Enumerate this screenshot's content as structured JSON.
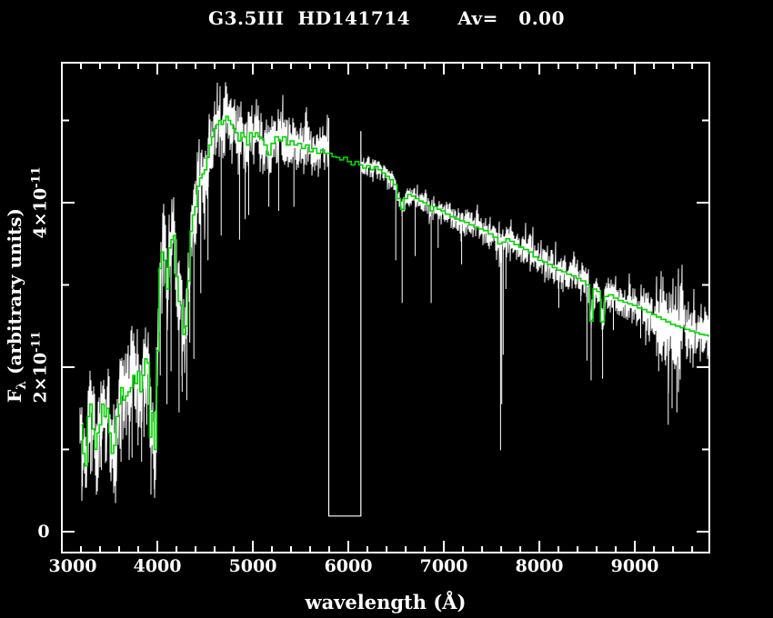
{
  "title": {
    "text": "G3.5III  HD141714       Av=   0.00"
  },
  "chart_data": {
    "type": "line",
    "title": "G3.5III  HD141714       Av=   0.00",
    "star": {
      "spectral_type": "G3.5III",
      "identifier": "HD141714",
      "av_label": "Av=",
      "av_value": "0.00"
    },
    "xlabel": "wavelength (Å)",
    "ylabel": "F_λ (arbitrary units)",
    "ylabel_parts": {
      "main": "F",
      "sub": "λ",
      "rest": " (arbitrary units)"
    },
    "flux_values_unit": "×10⁻¹¹ (arbitrary units)",
    "xlim": [
      3000,
      9780
    ],
    "ylim": [
      -0.25,
      5.7
    ],
    "grid": false,
    "legend": "none",
    "x_major_ticks": [
      3000,
      4000,
      5000,
      6000,
      7000,
      8000,
      9000
    ],
    "x_tick_labels": [
      "3000",
      "4000",
      "5000",
      "6000",
      "7000",
      "8000",
      "9000"
    ],
    "x_minor_step": 200,
    "y_major_ticks": [
      0,
      2,
      4
    ],
    "y_minor_ticks": [
      1,
      3,
      5
    ],
    "y_tick_labels": [
      {
        "value": 0,
        "label": "0"
      },
      {
        "value": 2,
        "base": "2×10",
        "exp": "-11"
      },
      {
        "value": 4,
        "base": "4×10",
        "exp": "-11"
      }
    ],
    "gap_box": {
      "x1": 5795,
      "x2": 6131,
      "top_left_flux": 5.03,
      "top_right_flux": 4.87,
      "bottom_flux": 0.19
    },
    "series": [
      {
        "name": "observed-spectrum",
        "color": "#ffffff",
        "style": "noisy",
        "x_start": 3185,
        "x_end": 9780,
        "gap": [
          5796,
          6130
        ],
        "noise_envelope": [
          [
            3185,
            0.45
          ],
          [
            3300,
            0.5
          ],
          [
            3450,
            0.5
          ],
          [
            3600,
            0.5
          ],
          [
            3750,
            0.5
          ],
          [
            3900,
            0.55
          ],
          [
            4000,
            0.5
          ],
          [
            4150,
            0.45
          ],
          [
            4300,
            0.42
          ],
          [
            4450,
            0.38
          ],
          [
            4600,
            0.35
          ],
          [
            4750,
            0.33
          ],
          [
            4900,
            0.32
          ],
          [
            5050,
            0.3
          ],
          [
            5200,
            0.28
          ],
          [
            5350,
            0.27
          ],
          [
            5500,
            0.25
          ],
          [
            5650,
            0.23
          ],
          [
            5795,
            0.21
          ],
          [
            6131,
            0.09
          ],
          [
            6300,
            0.09
          ],
          [
            6500,
            0.1
          ],
          [
            6700,
            0.1
          ],
          [
            6900,
            0.11
          ],
          [
            7100,
            0.12
          ],
          [
            7300,
            0.13
          ],
          [
            7500,
            0.14
          ],
          [
            7700,
            0.15
          ],
          [
            7900,
            0.16
          ],
          [
            8100,
            0.16
          ],
          [
            8300,
            0.17
          ],
          [
            8500,
            0.17
          ],
          [
            8700,
            0.17
          ],
          [
            8900,
            0.18
          ],
          [
            9050,
            0.2
          ],
          [
            9200,
            0.28
          ],
          [
            9300,
            0.5
          ],
          [
            9400,
            0.52
          ],
          [
            9500,
            0.4
          ],
          [
            9600,
            0.3
          ],
          [
            9700,
            0.28
          ],
          [
            9780,
            0.28
          ]
        ],
        "absorption_lines": [
          [
            3216,
            0.55
          ],
          [
            3248,
            0.58
          ],
          [
            3302,
            0.7
          ],
          [
            3415,
            0.75
          ],
          [
            3505,
            0.72
          ],
          [
            3560,
            0.7
          ],
          [
            3620,
            0.85
          ],
          [
            3735,
            0.9
          ],
          [
            3798,
            1.05
          ],
          [
            3835,
            0.85
          ],
          [
            3860,
            1.15
          ],
          [
            3890,
            1.3
          ],
          [
            3933,
            0.45
          ],
          [
            3968,
            0.52
          ],
          [
            4030,
            1.9
          ],
          [
            4101,
            1.55
          ],
          [
            4144,
            1.95
          ],
          [
            4227,
            1.45
          ],
          [
            4260,
            1.7
          ],
          [
            4308,
            1.6
          ],
          [
            4340,
            2.3
          ],
          [
            4383,
            2.1
          ],
          [
            4455,
            2.9
          ],
          [
            4530,
            3.3
          ],
          [
            4668,
            3.6
          ],
          [
            4861,
            3.55
          ],
          [
            4920,
            3.8
          ],
          [
            4957,
            3.85
          ],
          [
            5167,
            3.95
          ],
          [
            5270,
            3.9
          ],
          [
            5430,
            3.95
          ],
          [
            6497,
            3.3
          ],
          [
            6563,
            2.78
          ],
          [
            6700,
            3.35
          ],
          [
            6867,
            2.78
          ],
          [
            6940,
            3.45
          ],
          [
            7186,
            3.25
          ],
          [
            7594,
            0.99
          ],
          [
            7606,
            1.55
          ],
          [
            7621,
            2.15
          ],
          [
            7650,
            2.95
          ],
          [
            8204,
            2.72
          ],
          [
            8230,
            2.95
          ],
          [
            8434,
            2.8
          ],
          [
            8498,
            2.08
          ],
          [
            8542,
            1.84
          ],
          [
            8662,
            1.86
          ],
          [
            8775,
            2.45
          ],
          [
            9061,
            2.35
          ],
          [
            9250,
            1.95
          ],
          [
            9350,
            1.3
          ],
          [
            9390,
            1.5
          ],
          [
            9440,
            1.45
          ],
          [
            9475,
            1.85
          ]
        ]
      },
      {
        "name": "smoothed-spectrum",
        "color": "#00d400",
        "style": "steps",
        "points": [
          [
            3205,
            1.3
          ],
          [
            3230,
            0.95
          ],
          [
            3255,
            0.8
          ],
          [
            3280,
            1.4
          ],
          [
            3305,
            1.55
          ],
          [
            3330,
            1.25
          ],
          [
            3355,
            1.0
          ],
          [
            3380,
            1.2
          ],
          [
            3405,
            1.3
          ],
          [
            3430,
            1.55
          ],
          [
            3455,
            1.4
          ],
          [
            3480,
            1.5
          ],
          [
            3505,
            1.2
          ],
          [
            3530,
            0.95
          ],
          [
            3555,
            1.05
          ],
          [
            3580,
            1.4
          ],
          [
            3605,
            1.55
          ],
          [
            3630,
            1.75
          ],
          [
            3655,
            1.6
          ],
          [
            3680,
            1.65
          ],
          [
            3705,
            1.7
          ],
          [
            3730,
            1.75
          ],
          [
            3755,
            1.9
          ],
          [
            3780,
            1.8
          ],
          [
            3805,
            1.95
          ],
          [
            3830,
            1.7
          ],
          [
            3855,
            1.9
          ],
          [
            3880,
            2.1
          ],
          [
            3905,
            2.05
          ],
          [
            3930,
            1.15
          ],
          [
            3955,
            1.45
          ],
          [
            3980,
            1.0
          ],
          [
            4005,
            2.2
          ],
          [
            4030,
            3.2
          ],
          [
            4055,
            3.4
          ],
          [
            4080,
            3.3
          ],
          [
            4105,
            2.95
          ],
          [
            4130,
            3.45
          ],
          [
            4155,
            3.55
          ],
          [
            4180,
            3.6
          ],
          [
            4205,
            3.1
          ],
          [
            4230,
            2.8
          ],
          [
            4255,
            2.75
          ],
          [
            4280,
            2.4
          ],
          [
            4305,
            2.5
          ],
          [
            4330,
            3.05
          ],
          [
            4355,
            3.65
          ],
          [
            4380,
            3.85
          ],
          [
            4405,
            3.95
          ],
          [
            4430,
            4.2
          ],
          [
            4455,
            4.3
          ],
          [
            4480,
            4.35
          ],
          [
            4505,
            4.4
          ],
          [
            4530,
            4.55
          ],
          [
            4555,
            4.7
          ],
          [
            4580,
            4.8
          ],
          [
            4605,
            4.9
          ],
          [
            4630,
            4.95
          ],
          [
            4655,
            5.0
          ],
          [
            4680,
            4.95
          ],
          [
            4705,
            5.0
          ],
          [
            4730,
            5.05
          ],
          [
            4755,
            5.0
          ],
          [
            4780,
            4.95
          ],
          [
            4805,
            4.9
          ],
          [
            4830,
            4.85
          ],
          [
            4860,
            4.75
          ],
          [
            4890,
            4.85
          ],
          [
            4920,
            4.8
          ],
          [
            4950,
            4.7
          ],
          [
            4980,
            4.85
          ],
          [
            5010,
            4.8
          ],
          [
            5040,
            4.85
          ],
          [
            5070,
            4.8
          ],
          [
            5100,
            4.78
          ],
          [
            5130,
            4.7
          ],
          [
            5170,
            4.58
          ],
          [
            5210,
            4.72
          ],
          [
            5250,
            4.8
          ],
          [
            5290,
            4.75
          ],
          [
            5330,
            4.8
          ],
          [
            5370,
            4.7
          ],
          [
            5410,
            4.75
          ],
          [
            5450,
            4.7
          ],
          [
            5490,
            4.72
          ],
          [
            5530,
            4.66
          ],
          [
            5570,
            4.7
          ],
          [
            5610,
            4.62
          ],
          [
            5650,
            4.66
          ],
          [
            5690,
            4.6
          ],
          [
            5730,
            4.64
          ],
          [
            5770,
            4.6
          ],
          [
            5810,
            4.6
          ],
          [
            5850,
            4.56
          ],
          [
            5890,
            4.55
          ],
          [
            5930,
            4.52
          ],
          [
            5970,
            4.55
          ],
          [
            6010,
            4.5
          ],
          [
            6050,
            4.46
          ],
          [
            6090,
            4.5
          ],
          [
            6130,
            4.46
          ],
          [
            6170,
            4.42
          ],
          [
            6210,
            4.45
          ],
          [
            6250,
            4.4
          ],
          [
            6290,
            4.44
          ],
          [
            6330,
            4.4
          ],
          [
            6370,
            4.36
          ],
          [
            6410,
            4.32
          ],
          [
            6450,
            4.28
          ],
          [
            6490,
            4.22
          ],
          [
            6530,
            4.05
          ],
          [
            6565,
            3.92
          ],
          [
            6600,
            4.05
          ],
          [
            6640,
            4.1
          ],
          [
            6680,
            4.08
          ],
          [
            6720,
            4.05
          ],
          [
            6760,
            4.02
          ],
          [
            6800,
            4.0
          ],
          [
            6840,
            3.96
          ],
          [
            6875,
            3.9
          ],
          [
            6910,
            3.95
          ],
          [
            6950,
            3.92
          ],
          [
            6990,
            3.9
          ],
          [
            7040,
            3.86
          ],
          [
            7090,
            3.83
          ],
          [
            7140,
            3.8
          ],
          [
            7190,
            3.78
          ],
          [
            7240,
            3.76
          ],
          [
            7290,
            3.73
          ],
          [
            7340,
            3.7
          ],
          [
            7390,
            3.68
          ],
          [
            7440,
            3.66
          ],
          [
            7490,
            3.62
          ],
          [
            7540,
            3.58
          ],
          [
            7590,
            3.5
          ],
          [
            7630,
            3.52
          ],
          [
            7670,
            3.56
          ],
          [
            7710,
            3.53
          ],
          [
            7760,
            3.49
          ],
          [
            7810,
            3.46
          ],
          [
            7860,
            3.43
          ],
          [
            7910,
            3.4
          ],
          [
            7960,
            3.34
          ],
          [
            8010,
            3.3
          ],
          [
            8060,
            3.28
          ],
          [
            8110,
            3.25
          ],
          [
            8160,
            3.21
          ],
          [
            8210,
            3.18
          ],
          [
            8260,
            3.16
          ],
          [
            8310,
            3.13
          ],
          [
            8360,
            3.11
          ],
          [
            8410,
            3.08
          ],
          [
            8460,
            3.05
          ],
          [
            8510,
            3.0
          ],
          [
            8545,
            2.56
          ],
          [
            8580,
            2.95
          ],
          [
            8620,
            2.92
          ],
          [
            8660,
            2.55
          ],
          [
            8700,
            2.86
          ],
          [
            8750,
            2.88
          ],
          [
            8800,
            2.84
          ],
          [
            8850,
            2.81
          ],
          [
            8900,
            2.79
          ],
          [
            8950,
            2.77
          ],
          [
            9000,
            2.75
          ],
          [
            9050,
            2.72
          ],
          [
            9100,
            2.7
          ],
          [
            9150,
            2.67
          ],
          [
            9200,
            2.64
          ],
          [
            9250,
            2.61
          ],
          [
            9300,
            2.58
          ],
          [
            9350,
            2.55
          ],
          [
            9400,
            2.52
          ],
          [
            9450,
            2.5
          ],
          [
            9500,
            2.48
          ],
          [
            9550,
            2.46
          ],
          [
            9600,
            2.44
          ],
          [
            9650,
            2.42
          ],
          [
            9700,
            2.4
          ],
          [
            9750,
            2.39
          ],
          [
            9780,
            2.38
          ]
        ]
      }
    ],
    "colors": {
      "background": "#000000",
      "frame": "#ffffff",
      "observed": "#ffffff",
      "smoothed": "#00d400",
      "text": "#ffffff"
    }
  }
}
